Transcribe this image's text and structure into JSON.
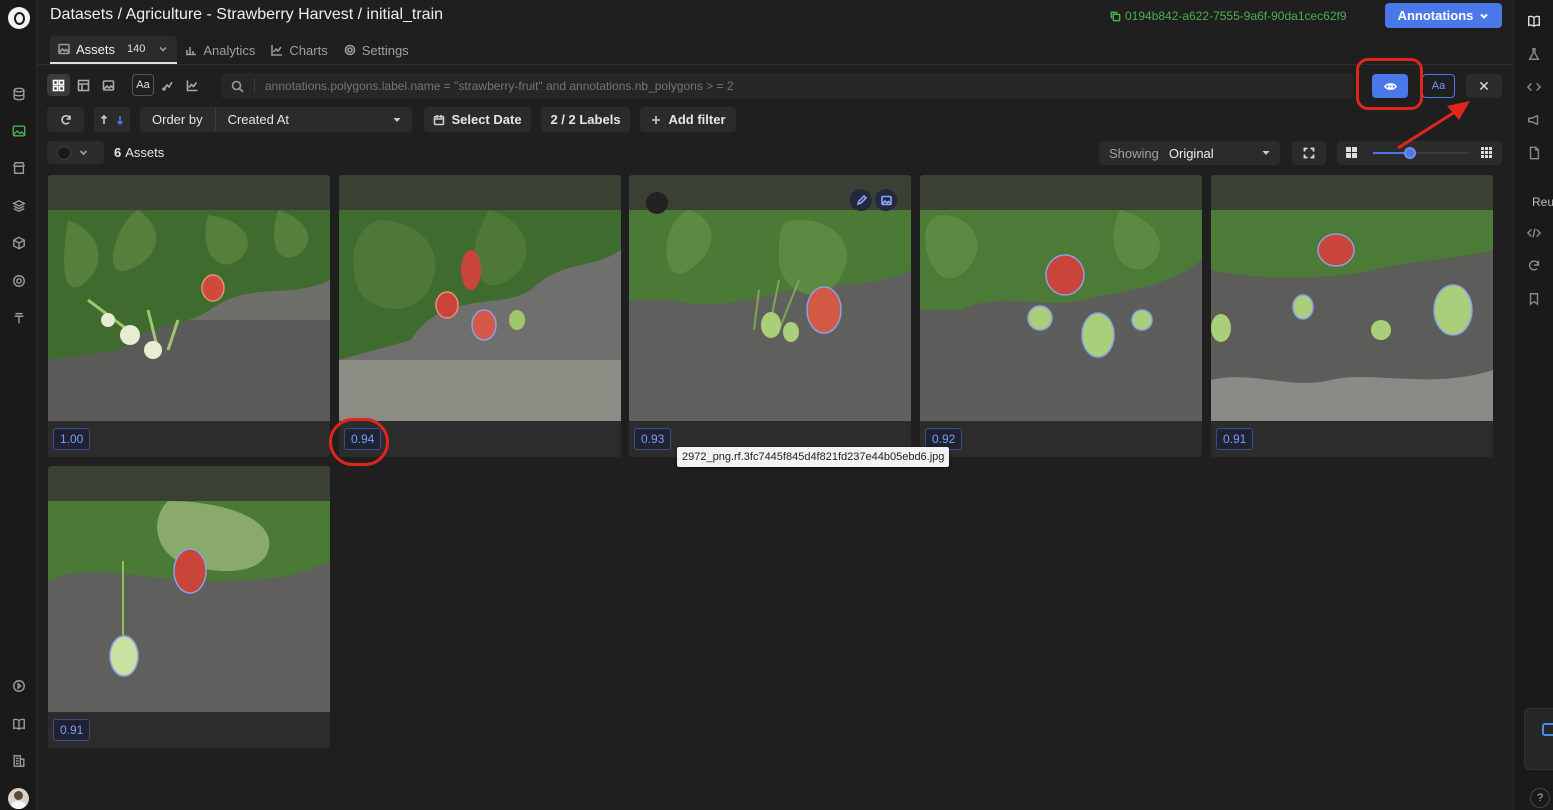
{
  "header": {
    "breadcrumb": "Datasets / Agriculture - Strawberry Harvest / initial_train",
    "dataset_id": "0194b842-a622-7555-9a6f-90da1cec62f9",
    "annotations_button": "Annotations"
  },
  "tabs": [
    {
      "label": "Assets",
      "count": "140",
      "icon": "image-icon"
    },
    {
      "label": "Analytics",
      "icon": "bar-chart-icon"
    },
    {
      "label": "Charts",
      "icon": "line-chart-icon"
    },
    {
      "label": "Settings",
      "icon": "gear-icon"
    }
  ],
  "toolbar": {
    "aa_label": "Aa",
    "search_placeholder": "annotations.polygons.label.name = \"strawberry-fruit\" and annotations.nb_polygons > = 2",
    "aa_toggle": "Aa",
    "close": "✕"
  },
  "filters": {
    "order_by_label": "Order by",
    "order_by_value": "Created At",
    "select_date": "Select Date",
    "labels": "2 / 2 Labels",
    "add_filter": "Add filter"
  },
  "assets_bar": {
    "count": "6",
    "count_label": "Assets",
    "showing_label": "Showing",
    "showing_value": "Original",
    "thumb_size_fraction": 0.39
  },
  "grid": {
    "cards": [
      {
        "score": "1.00"
      },
      {
        "score": "0.94"
      },
      {
        "score": "0.93"
      },
      {
        "score": "0.92"
      },
      {
        "score": "0.91"
      },
      {
        "score": "0.91"
      }
    ],
    "hover_tooltip": "2972_png.rf.3fc7445f845d4f821fd237e44b05ebd6.jpg"
  },
  "right_panel": {
    "partial_text": "Reu",
    "help": "?"
  },
  "colors": {
    "accent": "#4a78e8",
    "green": "#4caf50",
    "highlight_red": "#e0251c"
  }
}
